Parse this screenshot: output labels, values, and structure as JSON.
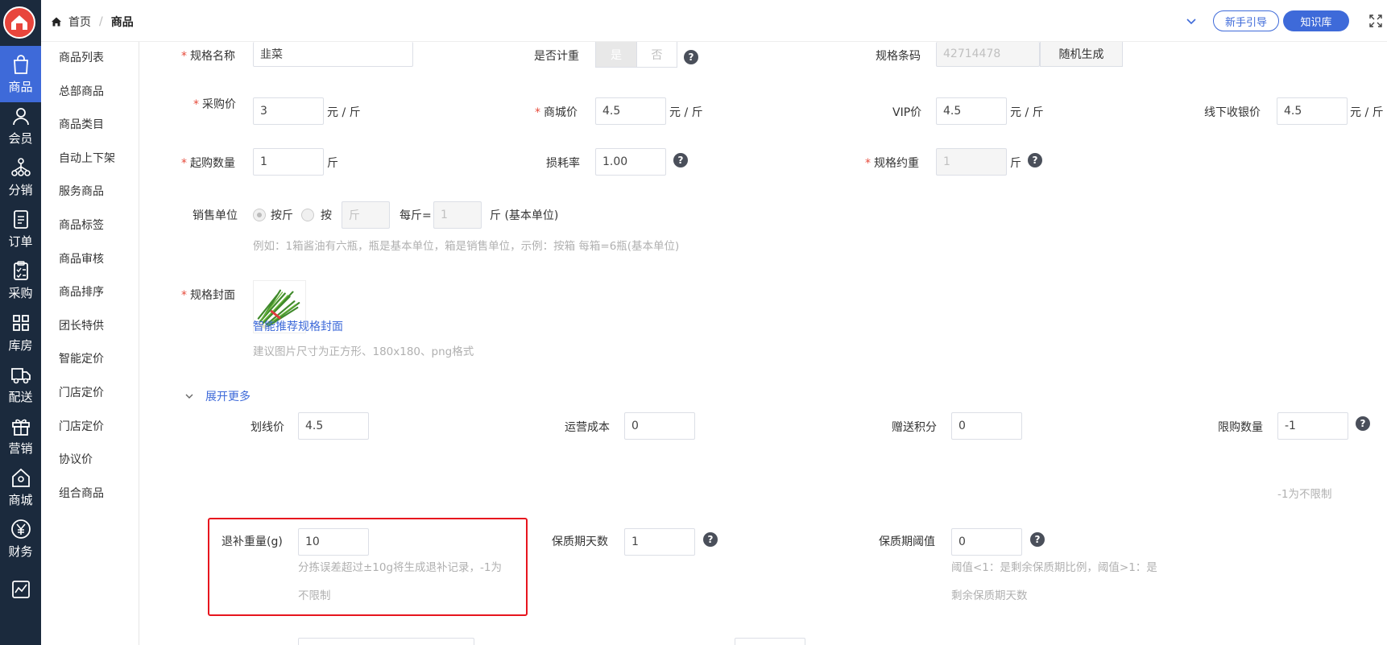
{
  "nav": {
    "items": [
      {
        "label": "商品",
        "icon": "bag-icon",
        "active": true
      },
      {
        "label": "会员",
        "icon": "user-icon"
      },
      {
        "label": "分销",
        "icon": "network-icon"
      },
      {
        "label": "订单",
        "icon": "document-icon"
      },
      {
        "label": "采购",
        "icon": "clipboard-icon"
      },
      {
        "label": "库房",
        "icon": "grid-icon"
      },
      {
        "label": "配送",
        "icon": "truck-icon"
      },
      {
        "label": "营销",
        "icon": "gift-icon"
      },
      {
        "label": "商城",
        "icon": "store-icon"
      },
      {
        "label": "财务",
        "icon": "yen-icon"
      },
      {
        "label": "",
        "icon": "chart-icon"
      }
    ]
  },
  "submenu": {
    "items": [
      "商品列表",
      "总部商品",
      "商品类目",
      "自动上下架",
      "服务商品",
      "商品标签",
      "商品审核",
      "商品排序",
      "团长特供",
      "智能定价",
      "门店定价",
      "门店定价",
      "协议价",
      "组合商品"
    ]
  },
  "header": {
    "breadcrumb": {
      "home": "首页",
      "separator": "/",
      "current": "商品"
    },
    "guide_button": "新手引导",
    "knowledge_button": "知识库"
  },
  "form": {
    "spec_name": {
      "label": "规格名称",
      "value": "韭菜"
    },
    "weighing": {
      "label": "是否计重",
      "yes": "是",
      "no": "否"
    },
    "barcode": {
      "label": "规格条码",
      "value": "42714478",
      "button": "随机生成"
    },
    "purchase_price": {
      "label": "采购价",
      "value": "3",
      "unit": "元 / 斤"
    },
    "mall_price": {
      "label": "商城价",
      "value": "4.5",
      "unit": "元 / 斤"
    },
    "vip_price": {
      "label": "VIP价",
      "value": "4.5",
      "unit": "元 / 斤"
    },
    "offline_price": {
      "label": "线下收银价",
      "value": "4.5",
      "unit": "元 / 斤"
    },
    "min_qty": {
      "label": "起购数量",
      "value": "1",
      "unit": "斤"
    },
    "loss_rate": {
      "label": "损耗率",
      "value": "1.00"
    },
    "spec_weight": {
      "label": "规格约重",
      "value": "1",
      "unit": "斤"
    },
    "sale_unit": {
      "label": "销售单位",
      "option1": "按斤",
      "option2": "按",
      "unit_placeholder": "斤",
      "per_label": "每斤=",
      "per_value": "1",
      "base_label": "斤 (基本单位)",
      "hint": "例如：1箱酱油有六瓶，瓶是基本单位，箱是销售单位，示例：按箱 每箱=6瓶(基本单位)"
    },
    "cover": {
      "label": "规格封面",
      "recommend_link": "智能推荐规格封面",
      "hint": "建议图片尺寸为正方形、180x180、png格式"
    },
    "expand": {
      "label": "展开更多"
    },
    "strike_price": {
      "label": "划线价",
      "value": "4.5"
    },
    "operating_cost": {
      "label": "运营成本",
      "value": "0"
    },
    "gift_points": {
      "label": "赠送积分",
      "value": "0"
    },
    "purchase_limit": {
      "label": "限购数量",
      "value": "-1",
      "hint": "-1为不限制"
    },
    "refund_weight": {
      "label": "退补重量(g)",
      "value": "10",
      "hint_line1": "分拣误差超过±10g将生成退补记录，-1为",
      "hint_line2": "不限制"
    },
    "shelf_life": {
      "label": "保质期天数",
      "value": "1"
    },
    "shelf_threshold": {
      "label": "保质期阈值",
      "value": "0",
      "hint_line1": "阈值<1：是剩余保质期比例，阈值>1：是",
      "hint_line2": "剩余保质期天数"
    }
  }
}
